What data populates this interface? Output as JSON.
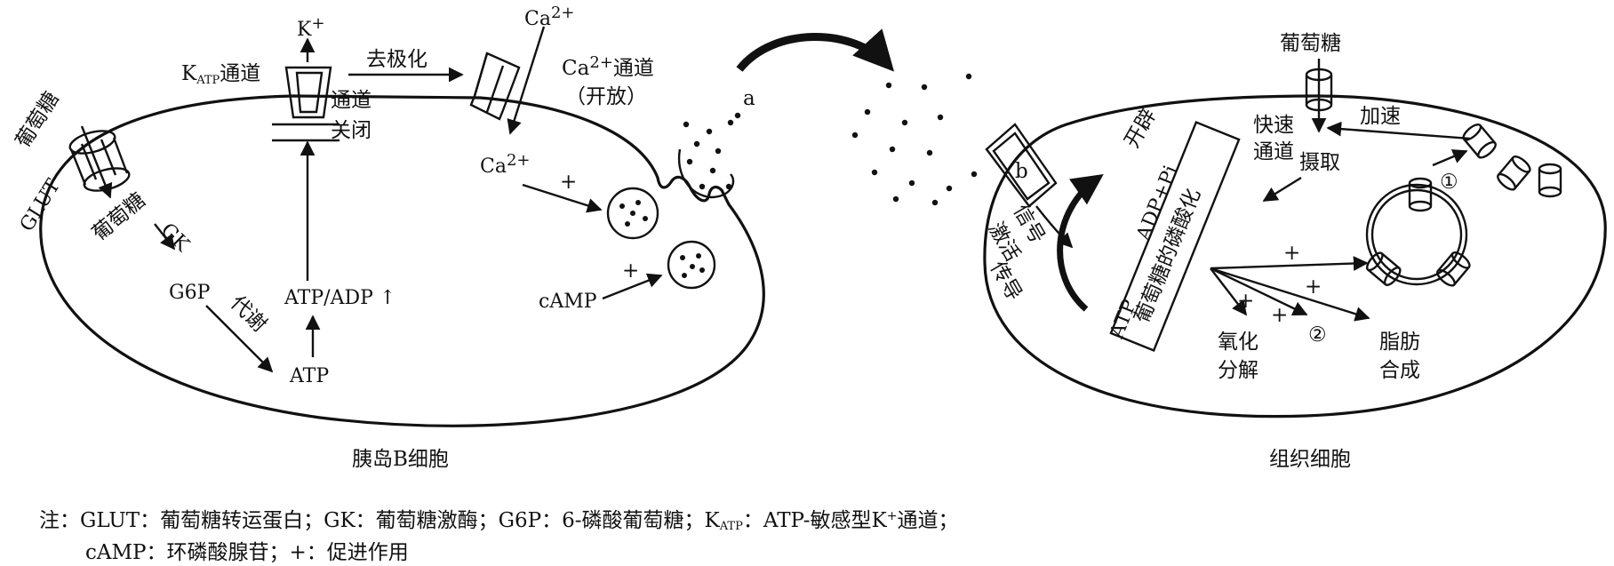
{
  "labels": {
    "k_ion": "K",
    "k_sup": "+",
    "katp_main": "K",
    "katp_sub": "ATP",
    "katp_tail": "通道",
    "channel_closed_1": "通道",
    "channel_closed_2": "关闭",
    "depolarization": "去极化",
    "ca_top": "Ca",
    "ca_sup": "2+",
    "ca_channel_1": "通道",
    "ca_channel_2": "（开放）",
    "ca_inner": "Ca",
    "plus": "+",
    "camp": "cAMP",
    "glut": "GLUT",
    "glucose": "葡萄糖",
    "glucose_inside": "葡萄糖",
    "gk": "GK",
    "g6p": "G6P",
    "metabolism": "代谢",
    "atp": "ATP",
    "atp_adp": "ATP/ADP ↑",
    "a": "a",
    "b": "b",
    "glucose_tissue": "葡萄糖",
    "accelerate": "加速",
    "open_1": "开辟",
    "fast_channel": "快速通道",
    "uptake": "摄取",
    "adp_pi": "ADP+Pi",
    "phosphorylation": "葡萄糖的磷酸化",
    "activation_1": "激活",
    "activation_2": "信号",
    "activation_3": "传导",
    "atp_tissue": "ATP",
    "circ_1": "①",
    "circ_2": "②",
    "oxidation_1": "氧化",
    "oxidation_2": "分解",
    "fat_1": "脂肪",
    "fat_2": "合成",
    "islet_cell": "胰岛B细胞",
    "tissue_cell": "组织细胞"
  },
  "note": {
    "line1_a": "注：GLUT：葡萄糖转运蛋白；GK：葡萄糖激酶；G6P：6-磷酸葡萄糖；K",
    "line1_sub": "ATP",
    "line1_b": "：ATP-敏感型K",
    "line1_sup": "+",
    "line1_c": "通道；",
    "line2": "cAMP：环磷酸腺苷；+：促进作用"
  }
}
